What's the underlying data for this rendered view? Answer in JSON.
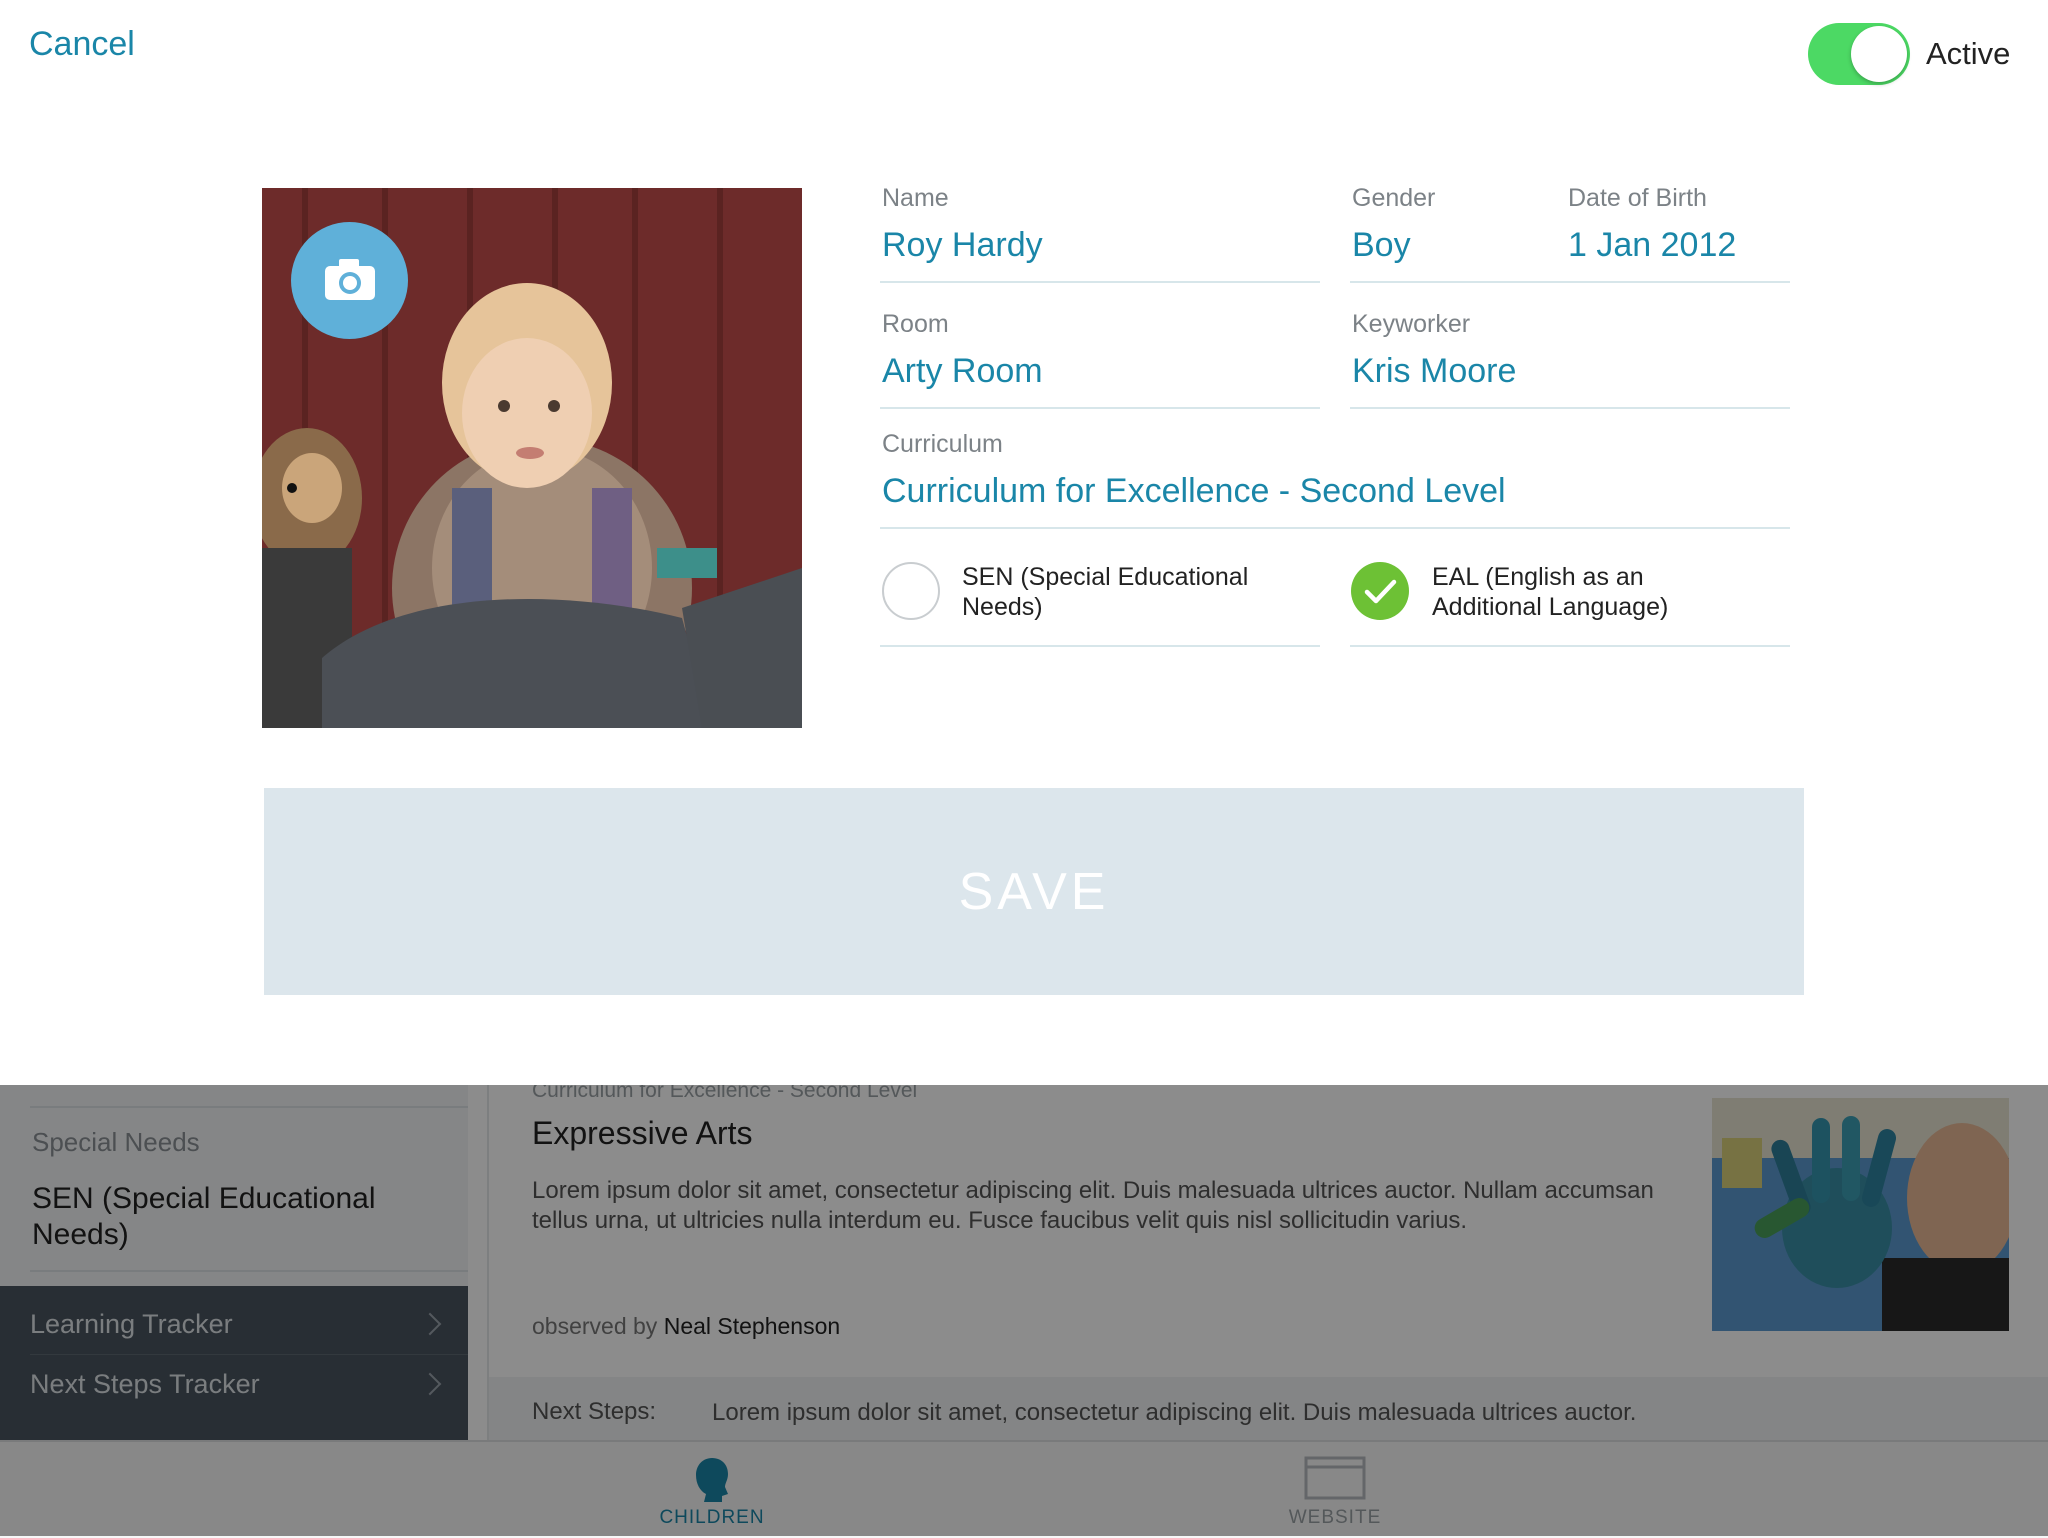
{
  "modal": {
    "cancel_label": "Cancel",
    "active_label": "Active",
    "active_on": true,
    "fields": {
      "name": {
        "label": "Name",
        "value": "Roy Hardy"
      },
      "gender": {
        "label": "Gender",
        "value": "Boy"
      },
      "dob": {
        "label": "Date of Birth",
        "value": "1 Jan 2012"
      },
      "room": {
        "label": "Room",
        "value": "Arty Room"
      },
      "keyworker": {
        "label": "Keyworker",
        "value": "Kris Moore"
      },
      "curriculum": {
        "label": "Curriculum",
        "value": "Curriculum for Excellence - Second Level"
      }
    },
    "options": {
      "sen": {
        "label": "SEN (Special Educational Needs)",
        "checked": false
      },
      "eal": {
        "label": "EAL (English as an Additional Language)",
        "checked": true
      }
    },
    "save_label": "SAVE"
  },
  "background": {
    "sidebar": {
      "special_needs_label": "Special Needs",
      "special_needs_value": "SEN (Special Educational Needs)",
      "trackers": [
        "Learning Tracker",
        "Next Steps Tracker"
      ]
    },
    "observation": {
      "curriculum": "Curriculum for Excellence - Second Level",
      "title": "Expressive Arts",
      "body": "Lorem ipsum dolor sit amet, consectetur adipiscing elit. Duis malesuada ultrices auctor. Nullam accumsan tellus urna, ut ultricies nulla interdum eu. Fusce faucibus velit quis nisl sollicitudin varius.",
      "observed_by_prefix": "observed by",
      "observer": "Neal Stephenson",
      "next_steps_label": "Next Steps:",
      "next_steps_text": "Lorem ipsum dolor sit amet, consectetur adipiscing elit. Duis malesuada ultrices auctor."
    },
    "tabs": [
      {
        "label": "CHILDREN",
        "active": true
      },
      {
        "label": "WEBSITE",
        "active": false
      }
    ]
  },
  "colors": {
    "accent": "#1a86a8",
    "toggle_on": "#4cd964",
    "check_on": "#6dc135",
    "save_bg": "#dce6ec"
  }
}
